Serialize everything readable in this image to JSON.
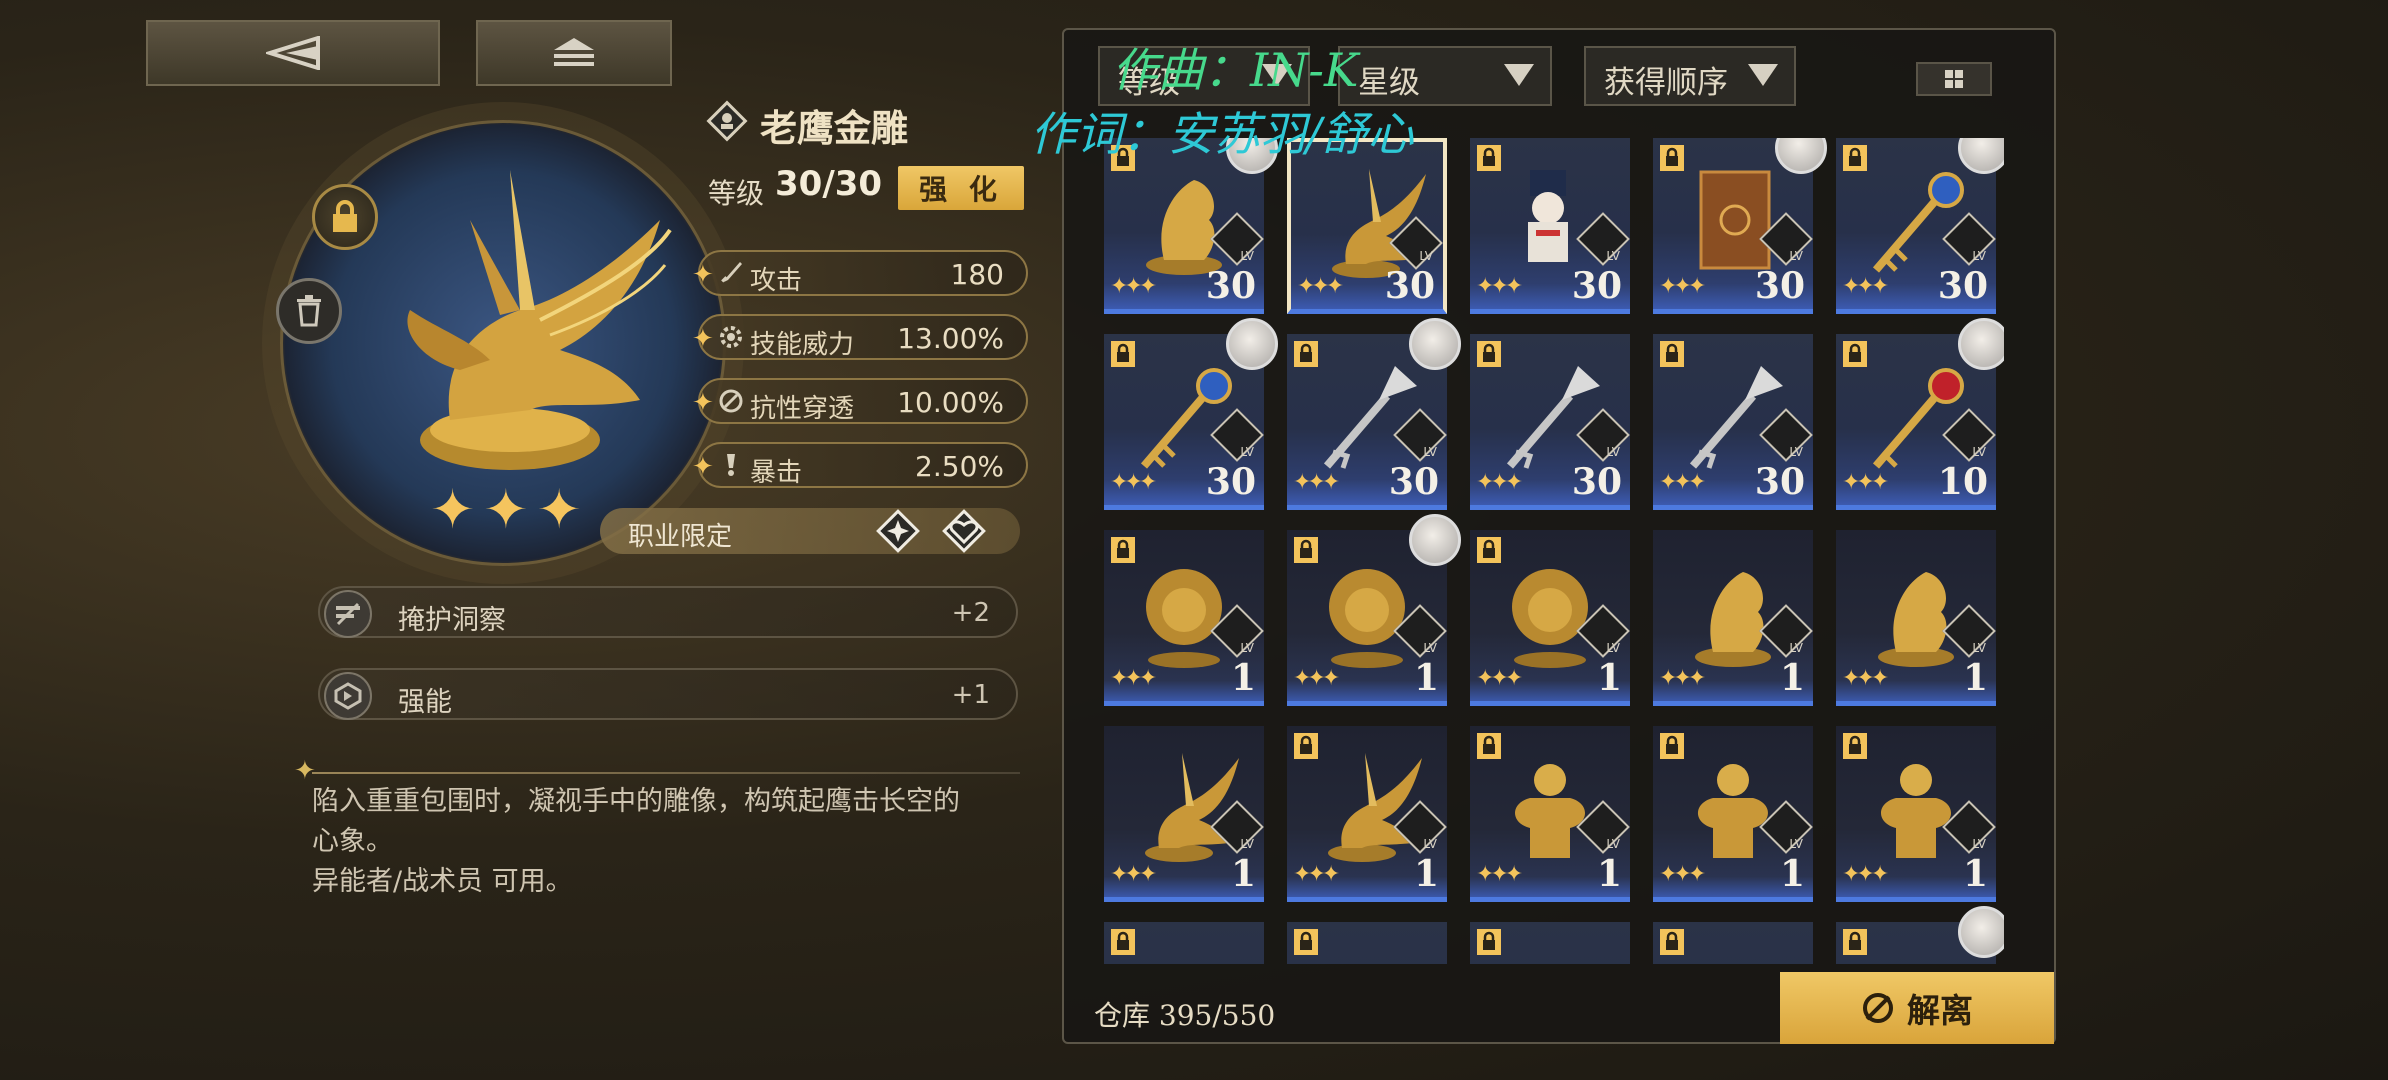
{
  "nav": {
    "back_icon": "back-arrow-icon",
    "home_icon": "home-icon"
  },
  "artifact": {
    "name": "老鹰金雕",
    "level_label": "等级",
    "level_value": "30/30",
    "enhance_label": "强 化",
    "stars": 3,
    "stats": [
      {
        "label": "攻击",
        "value": "180",
        "icon": "sword-icon"
      },
      {
        "label": "技能威力",
        "value": "13.00%",
        "icon": "gear-icon"
      },
      {
        "label": "抗性穿透",
        "value": "10.00%",
        "icon": "penetration-icon"
      },
      {
        "label": "暴击",
        "value": "2.50%",
        "icon": "crit-icon"
      }
    ],
    "profession_label": "职业限定",
    "skills": [
      {
        "label": "掩护洞察",
        "value": "+2"
      },
      {
        "label": "强能",
        "value": "+1"
      }
    ],
    "description_line1": "陷入重重包围时，凝视手中的雕像，构筑起鹰击长空的",
    "description_line2": "心象。",
    "description_line3": "异能者/战术员 可用。"
  },
  "sort": {
    "filter1": "等级",
    "filter2": "星级",
    "filter3": "获得顺序"
  },
  "inventory": {
    "items": [
      {
        "level": "30",
        "type": "horse",
        "locked": true,
        "avatar": true
      },
      {
        "level": "30",
        "type": "eagle",
        "locked": false,
        "avatar": false,
        "selected": true
      },
      {
        "level": "30",
        "type": "nutcracker",
        "locked": true,
        "avatar": false
      },
      {
        "level": "30",
        "type": "book",
        "locked": true,
        "avatar": true
      },
      {
        "level": "30",
        "type": "key-blue",
        "locked": true,
        "avatar": true
      },
      {
        "level": "30",
        "type": "key-blue",
        "locked": true,
        "avatar": true
      },
      {
        "level": "30",
        "type": "key-silver",
        "locked": true,
        "avatar": true
      },
      {
        "level": "30",
        "type": "key-silver",
        "locked": true,
        "avatar": false
      },
      {
        "level": "30",
        "type": "key-silver",
        "locked": true,
        "avatar": false
      },
      {
        "level": "10",
        "type": "key-red",
        "locked": true,
        "avatar": true
      },
      {
        "level": "1",
        "type": "lion",
        "locked": true,
        "avatar": false
      },
      {
        "level": "1",
        "type": "lion",
        "locked": true,
        "avatar": true
      },
      {
        "level": "1",
        "type": "lion",
        "locked": true,
        "avatar": false
      },
      {
        "level": "1",
        "type": "horse",
        "locked": false,
        "avatar": false
      },
      {
        "level": "1",
        "type": "horse",
        "locked": false,
        "avatar": false
      },
      {
        "level": "1",
        "type": "eagle",
        "locked": false,
        "avatar": false
      },
      {
        "level": "1",
        "type": "eagle",
        "locked": true,
        "avatar": false
      },
      {
        "level": "1",
        "type": "bust",
        "locked": true,
        "avatar": false
      },
      {
        "level": "1",
        "type": "bust",
        "locked": true,
        "avatar": false
      },
      {
        "level": "1",
        "type": "bust",
        "locked": true,
        "avatar": false
      },
      {
        "level": "",
        "type": "partial",
        "locked": true,
        "avatar": false
      },
      {
        "level": "",
        "type": "partial",
        "locked": true,
        "avatar": false
      },
      {
        "level": "",
        "type": "partial",
        "locked": true,
        "avatar": false
      },
      {
        "level": "",
        "type": "partial",
        "locked": true,
        "avatar": false
      },
      {
        "level": "",
        "type": "partial",
        "locked": true,
        "avatar": true
      }
    ],
    "lv_tag": "LV"
  },
  "footer": {
    "warehouse_label": "仓库",
    "warehouse_count": "395/550",
    "dismantle_label": "解离"
  },
  "overlay": {
    "line1": "作曲：IN-K",
    "line2": "作词：安苏羽/舒心"
  }
}
